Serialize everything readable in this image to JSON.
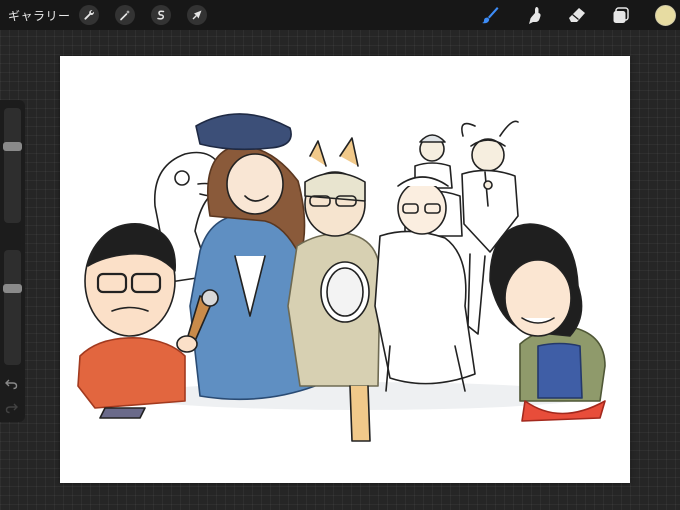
{
  "topbar": {
    "gallery_label": "ギャラリー",
    "left_tools": [
      {
        "name": "actions",
        "icon": "wrench-icon"
      },
      {
        "name": "adjustments",
        "icon": "magic-wand-icon"
      },
      {
        "name": "selection",
        "icon": "selection-s-icon"
      },
      {
        "name": "transform",
        "icon": "arrow-cursor-icon"
      }
    ],
    "right_tools": [
      {
        "name": "brush",
        "icon": "brush-icon",
        "active": true
      },
      {
        "name": "smudge",
        "icon": "smudge-finger-icon"
      },
      {
        "name": "eraser",
        "icon": "eraser-icon"
      },
      {
        "name": "layers",
        "icon": "layers-icon"
      }
    ],
    "current_color": "#e7dca2"
  },
  "sidebar": {
    "brush_size_level": 0.32,
    "opacity_level": 0.68,
    "undo_icon": "undo-arrow-icon",
    "redo_icon": "redo-arrow-icon"
  },
  "colors": {
    "active_tool": "#3d8cf6",
    "inactive_tool": "#e6e6e6",
    "frame": "#171717"
  },
  "canvas": {
    "content": "illustration-people-group"
  }
}
